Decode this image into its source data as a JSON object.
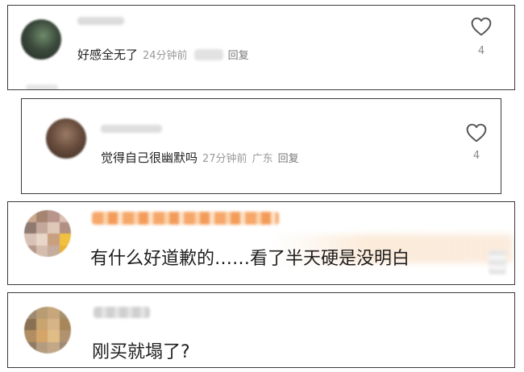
{
  "comments": [
    {
      "text": "好感全无了",
      "time": "24分钟前",
      "location": "",
      "reply_label": "回复",
      "likes": "4"
    },
    {
      "text": "觉得自己很幽默吗",
      "time": "27分钟前",
      "location": "广东",
      "reply_label": "回复",
      "likes": "4"
    },
    {
      "text": "有什么好道歉的……看了半天硬是没明白"
    },
    {
      "text": "刚买就塌了?"
    }
  ],
  "colors": {
    "border": "#3a3a3a",
    "meta_gray": "#9a9a9a",
    "heart_stroke": "#555555",
    "orange_name": "#f4a25a"
  },
  "icons": {
    "like": "heart-outline-icon"
  }
}
